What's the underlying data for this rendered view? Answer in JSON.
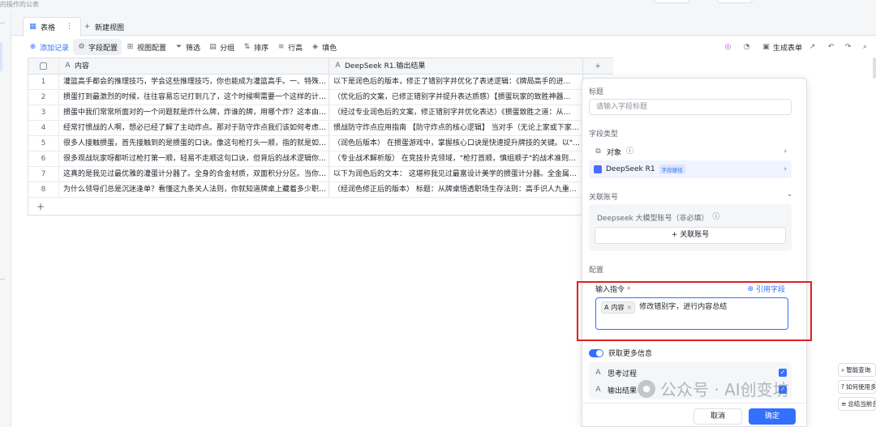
{
  "breadcrumb_partial": "的操作的公表",
  "tabs": {
    "active_label": "表格",
    "new_view_label": "新建视图"
  },
  "toolbar": {
    "add_record": "添加记录",
    "field_config": "字段配置",
    "view_config": "视图配置",
    "filter": "筛选",
    "group": "分组",
    "sort": "排序",
    "row_height": "行高",
    "fill_color": "填色",
    "generate_form": "生成表单"
  },
  "grid": {
    "col_content": "内容",
    "col_result": "DeepSeek R1.输出结果",
    "rows": [
      {
        "num": "1",
        "content": "灌篮高手都会的推理技巧，学会这些推理技巧，你也能成为灌篮高手。一、特殊…",
        "result": "以下是润色后的版本，修正了错别字并优化了表述逻辑：《牌局高手的进…"
      },
      {
        "num": "2",
        "content": "掼蛋打到最激烈的时候，往往容易忘记打到几了，这个时候啊需要一个这样的计…",
        "result": "（优化后的文案，已修正错别字并提升表达质感）【掼蛋玩家的致胜神器…"
      },
      {
        "num": "3",
        "content": "掼蛋中我们常常所面对的一个问题就是炸什么牌，炸谁的牌，用哪个炸？这本由…",
        "result": "（经过专业润色后的文案，修正错别字并优化表达）《掼蛋致胜之道：从…"
      },
      {
        "num": "4",
        "content": "经常打惯战的人啊，想必已经了解了主动炸点。那对于防守炸点我们该如何考虑…",
        "result": "惯战防守炸点应用指南 【防守炸点的核心逻辑】 当对手（无论上家或下家…"
      },
      {
        "num": "5",
        "content": "很多人接触掼蛋，首先接触到的是掼蛋的口诀。像这句枪打头一顺，指的就是如…",
        "result": "（润色后版本） 在掼蛋游戏中，掌握核心口诀是快速提升牌技的关键。以\"…"
      },
      {
        "num": "6",
        "content": "很多观战玩家呀都听过枪打第一顺，轻易不走顺这句口诀，但背后的战术逻辑你…",
        "result": "（专业战术解析版） 在竞技扑克领域，\"枪打首顺，慎组顺子\"的战术准则…"
      },
      {
        "num": "7",
        "content": "这真的是我见过最优雅的灌蛋计分器了。全身的合金材质，双面积分分区。当你…",
        "result": "以下为润色后的文本： 这堪称我见过最富设计美学的掼蛋计分器。全金属…"
      },
      {
        "num": "8",
        "content": "为什么领导们总是沉迷逢单？看懂这九条关人法则，你就知道牌桌上藏着多少职…",
        "result": "（经润色修正后的版本） 标题：从牌桌悟透职场生存法则：高手识人九重…"
      }
    ]
  },
  "panel": {
    "title_label": "标题",
    "title_placeholder": "请输入字段标题",
    "field_type_label": "字段类型",
    "type_object": "对象",
    "type_deepseek": "DeepSeek R1",
    "deepseek_badge": "字段捷径",
    "linked_account_label": "关联账号",
    "account_box_title": "Deepseek 大模型账号（非必填）",
    "link_account_button": "关联账号",
    "config_label": "配置",
    "prompt_label": "输入指令",
    "prompt_required": "*",
    "ref_field": "引用字段",
    "prompt_tag": "内容",
    "prompt_text": "修改错别字，进行内容总结",
    "more_info_label": "获取更多信息",
    "opt_thinking": "思考过程",
    "opt_output": "输出结果",
    "cancel": "取消",
    "confirm": "确定"
  },
  "side_chips": [
    "智能查询",
    "如何使用多维",
    "总结当前多维"
  ],
  "watermark": {
    "text": "公众号 · AI创变坊"
  },
  "colors": {
    "accent": "#3370ff",
    "highlight_frame": "#e02020"
  }
}
